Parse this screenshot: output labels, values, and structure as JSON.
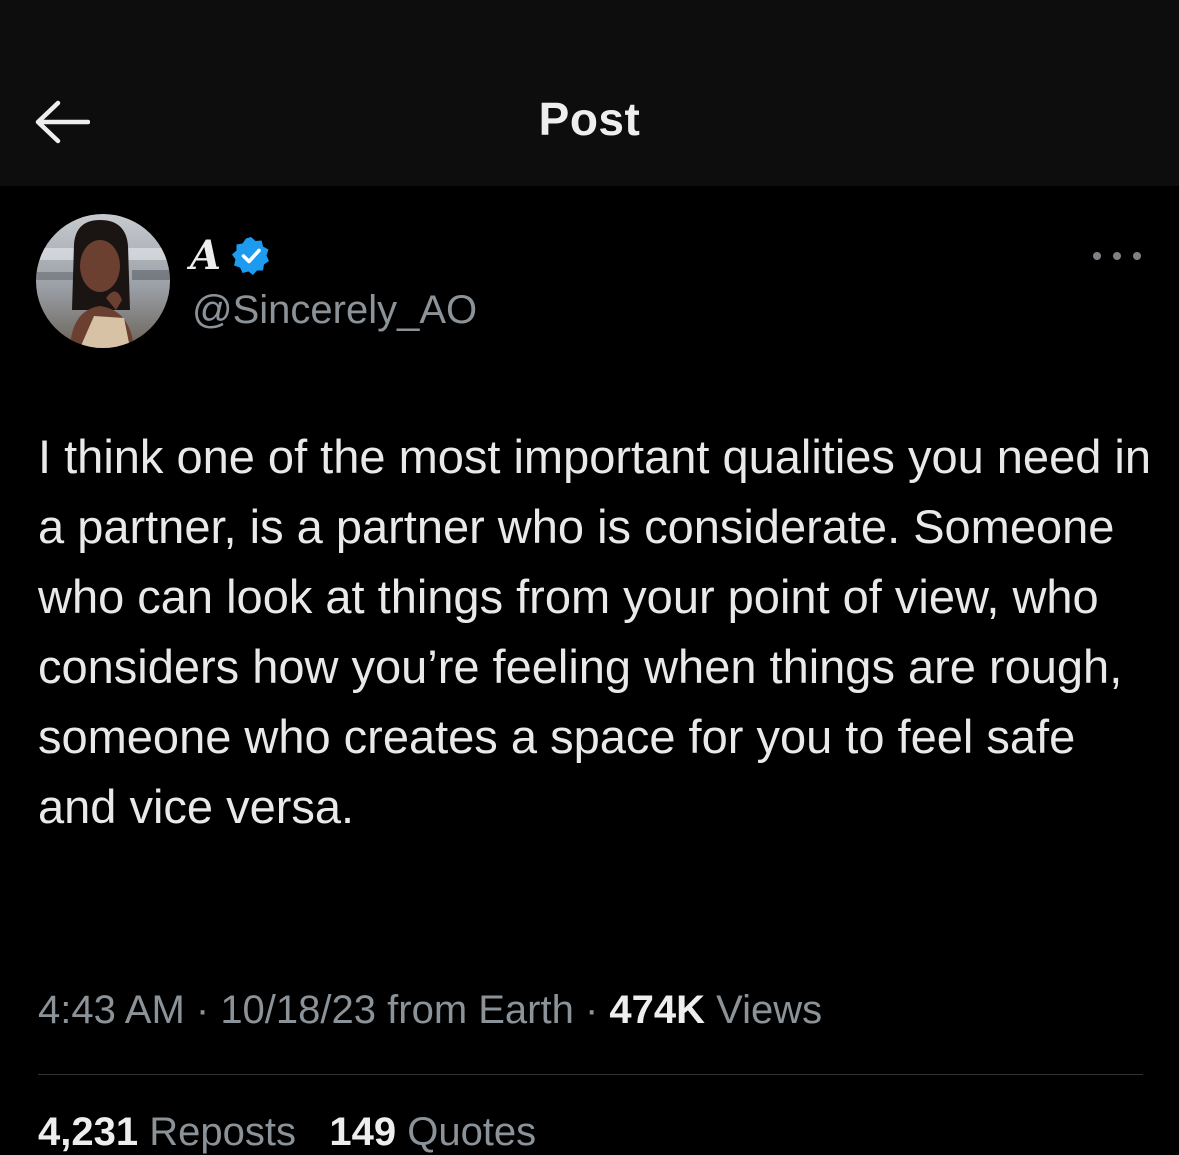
{
  "header": {
    "title": "Post",
    "back_icon": "arrow-left-icon"
  },
  "author": {
    "display_name": "A",
    "handle": "@Sincerely_AO",
    "verified_icon": "verified-badge-icon",
    "verified_color": "#1d9bf0"
  },
  "post": {
    "text": "I think one of the most important qualities you need in a partner, is a partner who is considerate. Someone who can look at things from your point of view, who considers how you’re feeling when things are rough, someone who creates a space for you to feel safe and vice versa.",
    "time": "4:43 AM",
    "date": "10/18/23",
    "location": "from Earth",
    "views_count": "474K",
    "views_label": "Views",
    "more_icon": "more-horizontal-icon"
  },
  "stats": {
    "reposts_count": "4,231",
    "reposts_label": "Reposts",
    "quotes_count": "149",
    "quotes_label": "Quotes"
  },
  "colors": {
    "background": "#000000",
    "header_background": "#0d0d0d",
    "text_primary": "#e7e9ea",
    "text_secondary": "#8b9298",
    "divider": "#2f3336"
  }
}
